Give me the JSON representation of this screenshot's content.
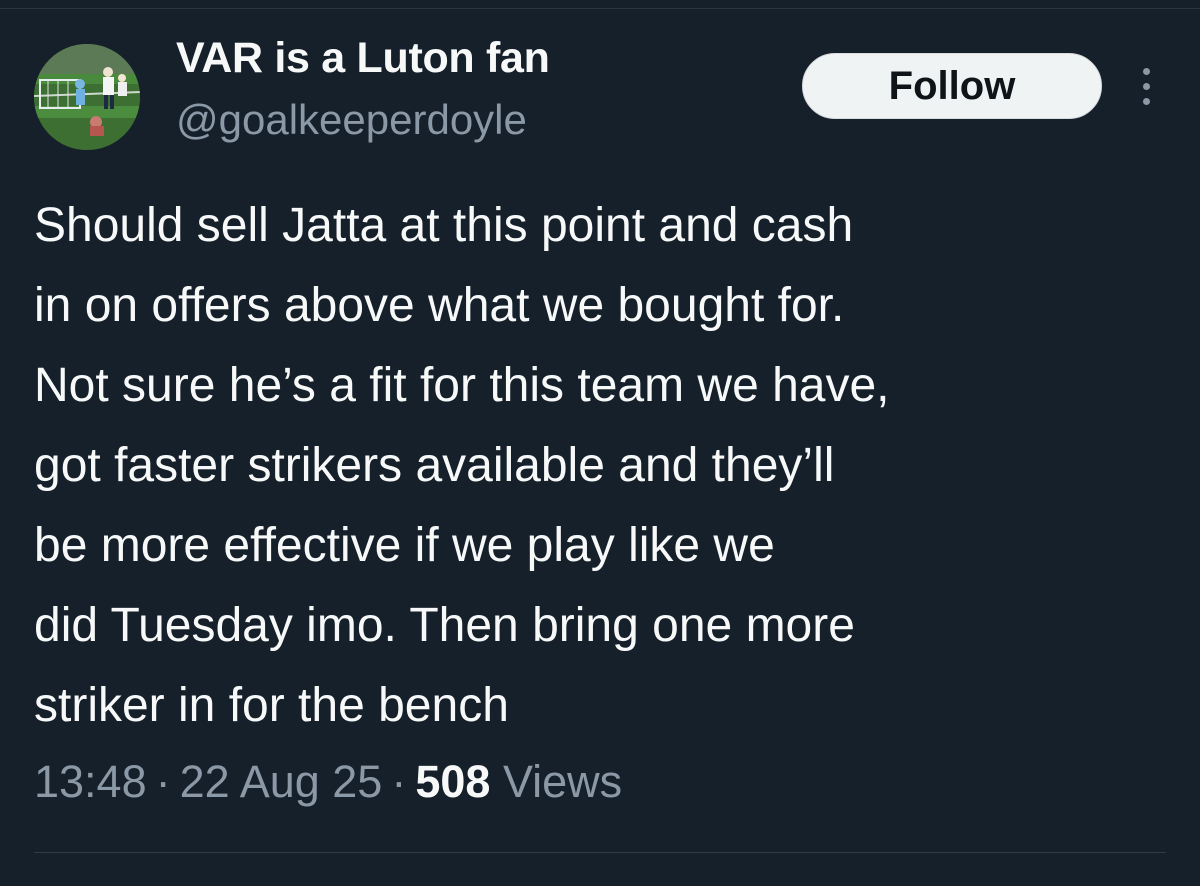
{
  "author": {
    "display_name": "VAR is a Luton fan",
    "handle": "@goalkeeperdoyle"
  },
  "actions": {
    "follow_label": "Follow",
    "more_icon": "more-vertical-icon"
  },
  "tweet": {
    "lines": [
      "Should sell Jatta at this point and cash",
      "in on offers above what we bought for.",
      "Not sure he’s a fit for this team we have,",
      "got faster strikers available and they’ll",
      "be more effective if we play like we",
      "did Tuesday imo. Then bring one more",
      "striker in for the bench"
    ]
  },
  "meta": {
    "time": "13:48",
    "separator": "·",
    "date": "22 Aug 25",
    "views_count": "508",
    "views_label": "Views"
  },
  "colors": {
    "background": "#16202b",
    "text_primary": "#f7f9f9",
    "text_secondary": "#8b98a5",
    "follow_bg": "#eff3f4"
  }
}
